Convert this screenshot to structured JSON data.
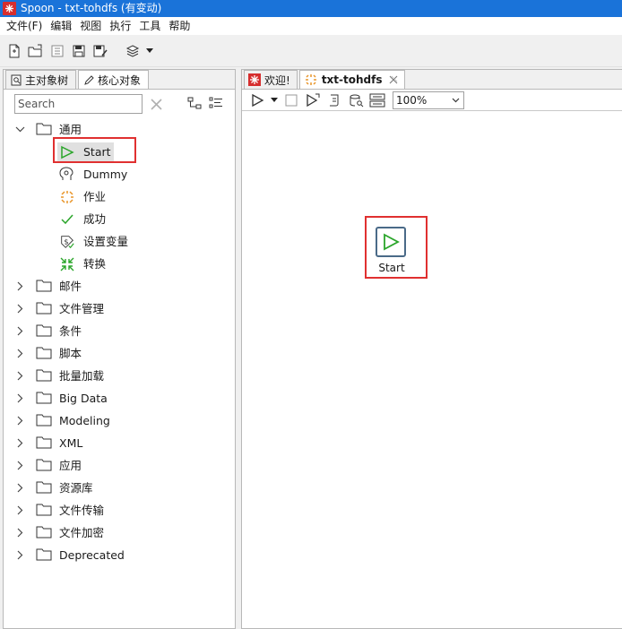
{
  "window": {
    "title": "Spoon - txt-tohdfs (有变动)"
  },
  "menu": [
    "文件(F)",
    "编辑",
    "视图",
    "执行",
    "工具",
    "帮助"
  ],
  "left_panel": {
    "tabs": [
      {
        "label": "主对象树",
        "icon": "tree-search-icon"
      },
      {
        "label": "核心对象",
        "icon": "pencil-icon"
      }
    ],
    "search_placeholder": "Search",
    "tree": {
      "expanded_folder": "通用",
      "children": [
        "Start",
        "Dummy",
        "作业",
        "成功",
        "设置变量",
        "转换"
      ],
      "folders": [
        "邮件",
        "文件管理",
        "条件",
        "脚本",
        "批量加载",
        "Big Data",
        "Modeling",
        "XML",
        "应用",
        "资源库",
        "文件传输",
        "文件加密",
        "Deprecated"
      ]
    }
  },
  "right_panel": {
    "tabs": [
      {
        "label": "欢迎!",
        "icon": "spoon-icon"
      },
      {
        "label": "txt-tohdfs",
        "icon": "job-icon"
      }
    ],
    "zoom": "100%",
    "canvas_step": {
      "label": "Start"
    }
  },
  "colors": {
    "titlebar": "#1a73d9",
    "highlight": "#e03030",
    "start_green": "#2aa52a"
  }
}
